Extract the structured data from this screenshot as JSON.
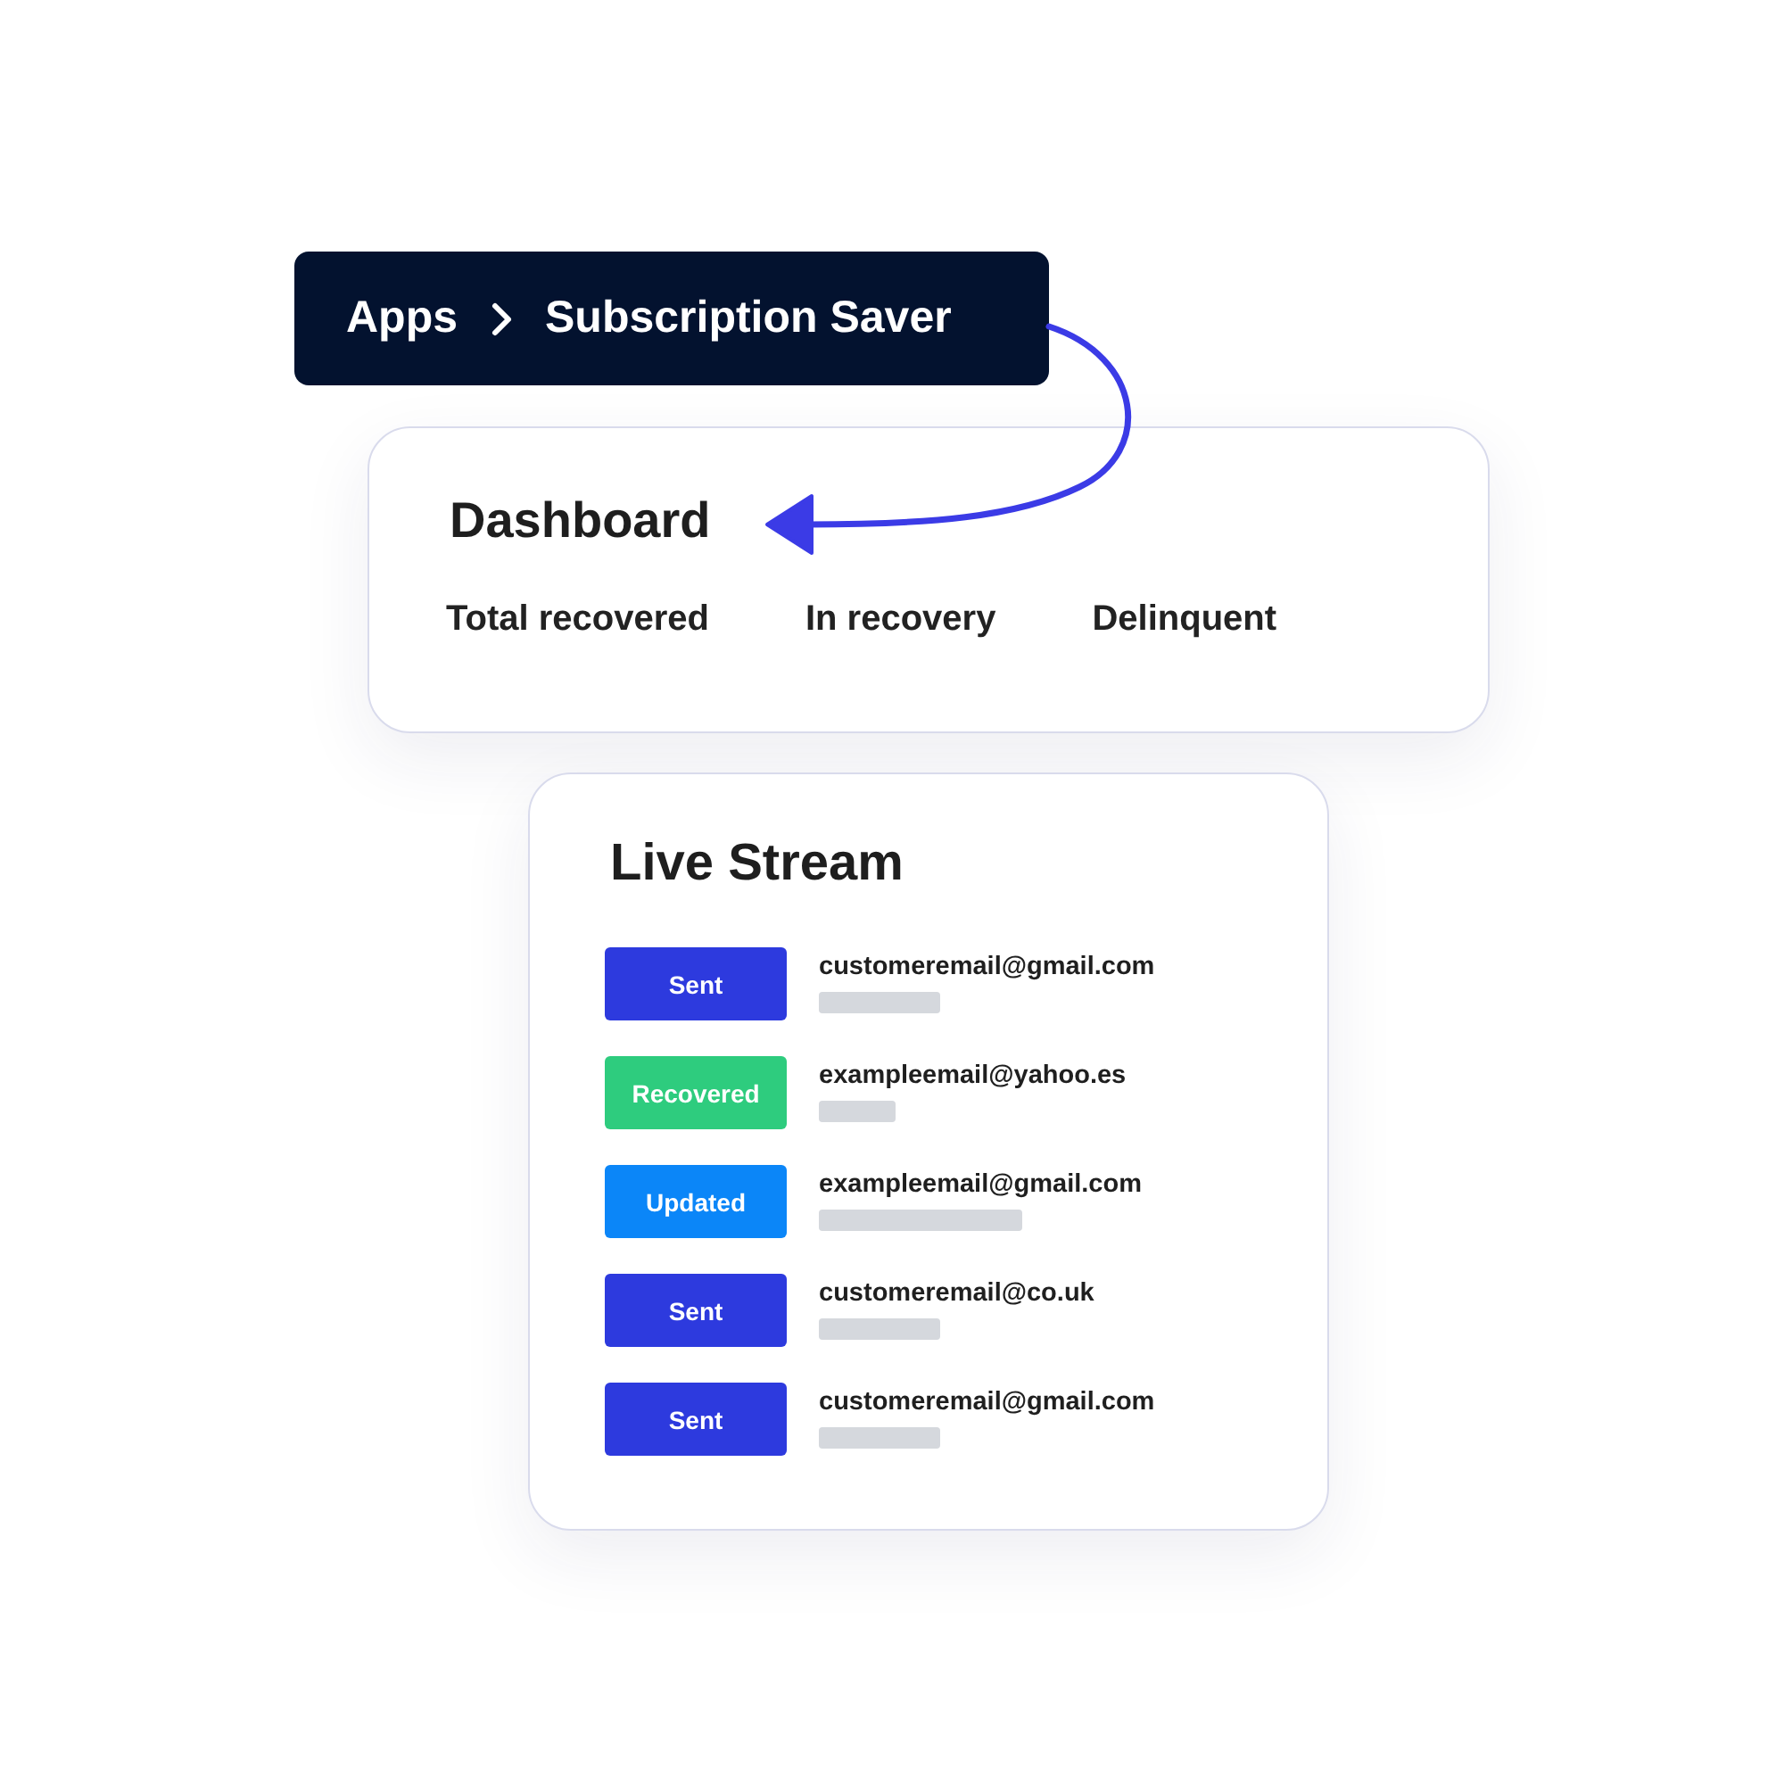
{
  "breadcrumb": {
    "items": [
      {
        "label": "Apps"
      },
      {
        "label": "Subscription Saver"
      }
    ]
  },
  "dashboard": {
    "title": "Dashboard",
    "metric_labels": [
      "Total recovered",
      "In recovery",
      "Delinquent"
    ]
  },
  "live_stream": {
    "title": "Live Stream",
    "events": [
      {
        "status": "Sent",
        "color": "#2d3ade",
        "email": "customeremail@gmail.com"
      },
      {
        "status": "Recovered",
        "color": "#2ecc7e",
        "email": "exampleemail@yahoo.es"
      },
      {
        "status": "Updated",
        "color": "#0b86f8",
        "email": "exampleemail@gmail.com"
      },
      {
        "status": "Sent",
        "color": "#2d3ade",
        "email": "customeremail@co.uk"
      },
      {
        "status": "Sent",
        "color": "#2d3ade",
        "email": "customeremail@gmail.com"
      }
    ]
  }
}
